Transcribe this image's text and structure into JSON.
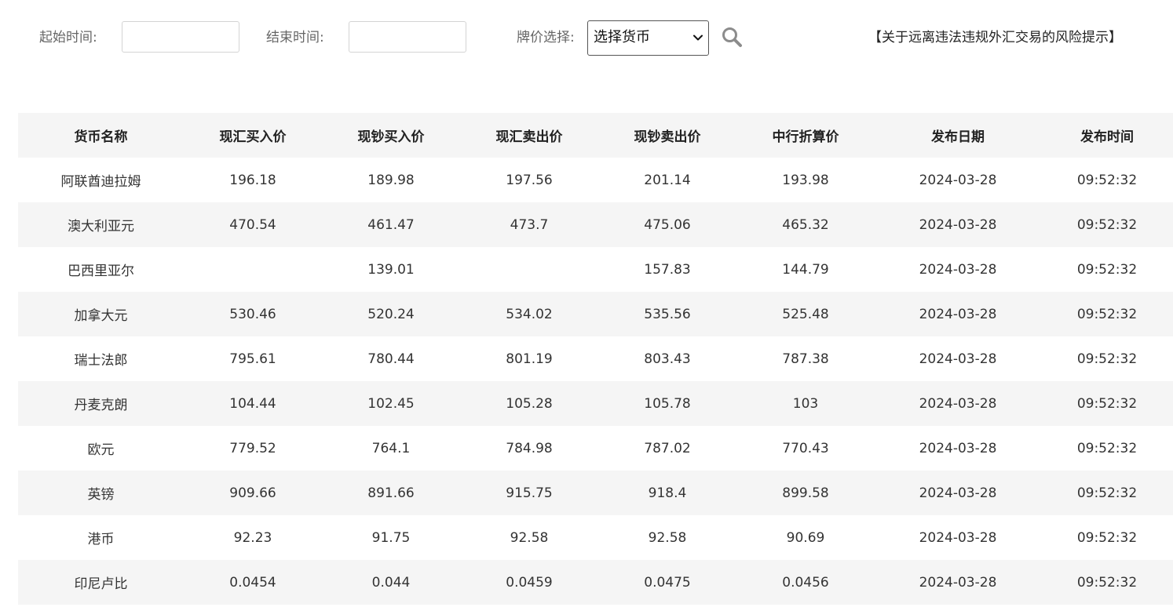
{
  "filters": {
    "start_label": "起始时间:",
    "start_value": "",
    "end_label": "结束时间:",
    "end_value": "",
    "price_label": "牌价选择:",
    "currency_select": {
      "selected": "选择货币"
    },
    "risk_notice": "【关于远离违法违规外汇交易的风险提示】"
  },
  "table": {
    "headers": [
      "货币名称",
      "现汇买入价",
      "现钞买入价",
      "现汇卖出价",
      "现钞卖出价",
      "中行折算价",
      "发布日期",
      "发布时间"
    ],
    "rows": [
      [
        "阿联酋迪拉姆",
        "196.18",
        "189.98",
        "197.56",
        "201.14",
        "193.98",
        "2024-03-28",
        "09:52:32"
      ],
      [
        "澳大利亚元",
        "470.54",
        "461.47",
        "473.7",
        "475.06",
        "465.32",
        "2024-03-28",
        "09:52:32"
      ],
      [
        "巴西里亚尔",
        "",
        "139.01",
        "",
        "157.83",
        "144.79",
        "2024-03-28",
        "09:52:32"
      ],
      [
        "加拿大元",
        "530.46",
        "520.24",
        "534.02",
        "535.56",
        "525.48",
        "2024-03-28",
        "09:52:32"
      ],
      [
        "瑞士法郎",
        "795.61",
        "780.44",
        "801.19",
        "803.43",
        "787.38",
        "2024-03-28",
        "09:52:32"
      ],
      [
        "丹麦克朗",
        "104.44",
        "102.45",
        "105.28",
        "105.78",
        "103",
        "2024-03-28",
        "09:52:32"
      ],
      [
        "欧元",
        "779.52",
        "764.1",
        "784.98",
        "787.02",
        "770.43",
        "2024-03-28",
        "09:52:32"
      ],
      [
        "英镑",
        "909.66",
        "891.66",
        "915.75",
        "918.4",
        "899.58",
        "2024-03-28",
        "09:52:32"
      ],
      [
        "港币",
        "92.23",
        "91.75",
        "92.58",
        "92.58",
        "90.69",
        "2024-03-28",
        "09:52:32"
      ],
      [
        "印尼卢比",
        "0.0454",
        "0.044",
        "0.0459",
        "0.0475",
        "0.0456",
        "2024-03-28",
        "09:52:32"
      ]
    ]
  },
  "icons": {
    "search": "search-icon",
    "dropdown": "chevron-down-icon"
  },
  "colors": {
    "header_bg": "#f5f5f5",
    "stripe_bg": "#f5f5f5",
    "label_text": "#666666",
    "body_text": "#333333"
  }
}
